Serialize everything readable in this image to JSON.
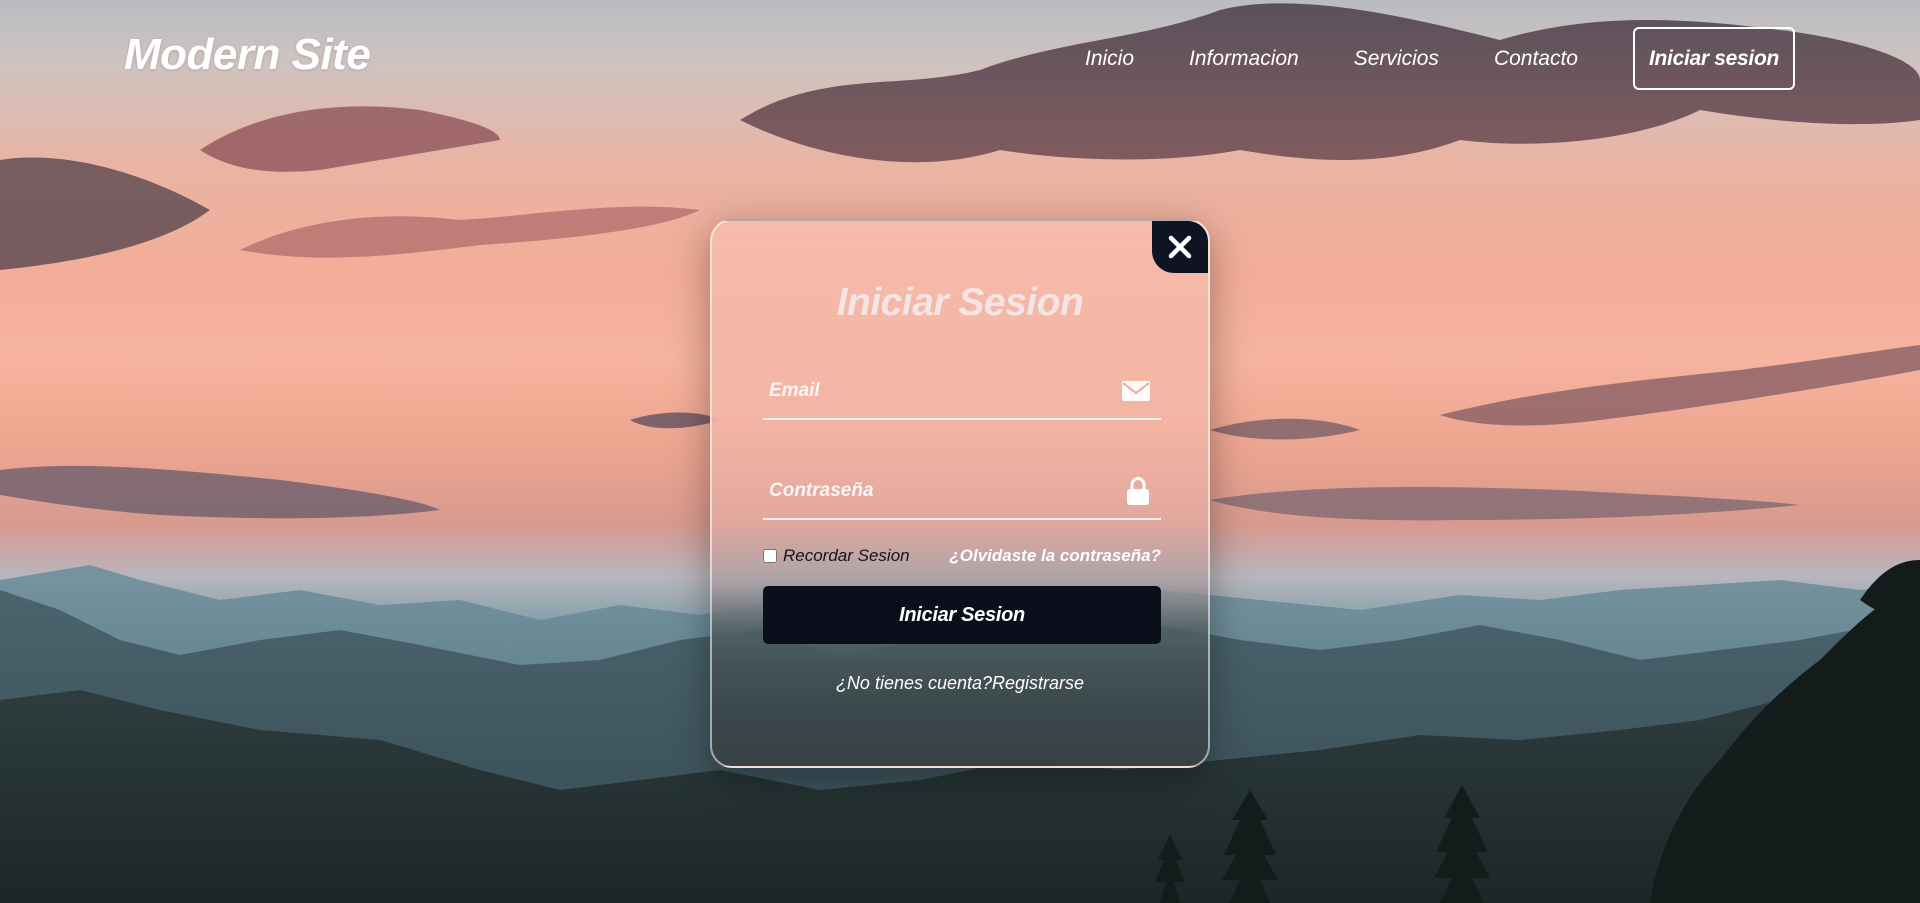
{
  "header": {
    "logo": "Modern Site",
    "nav": [
      "Inicio",
      "Informacion",
      "Servicios",
      "Contacto"
    ],
    "login_button": "Iniciar sesion"
  },
  "modal": {
    "title": "Iniciar Sesion",
    "email_placeholder": "Email",
    "password_placeholder": "Contraseña",
    "remember_label": "Recordar Sesion",
    "forgot_link": "¿Olvidaste la contraseña?",
    "submit_label": "Iniciar Sesion",
    "register_prompt": "¿No tienes cuenta?",
    "register_link": "Registrarse"
  },
  "icons": {
    "close": "close-icon",
    "email": "envelope-icon",
    "password": "lock-icon"
  },
  "colors": {
    "button_dark": "#0b0f1c",
    "text_light": "#ffffff"
  }
}
